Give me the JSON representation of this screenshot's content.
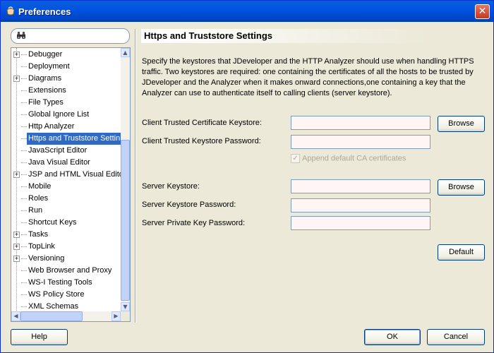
{
  "window": {
    "title": "Preferences"
  },
  "search": {
    "placeholder": ""
  },
  "tree": {
    "items": [
      {
        "label": "Debugger",
        "expandable": true
      },
      {
        "label": "Deployment",
        "expandable": false
      },
      {
        "label": "Diagrams",
        "expandable": true
      },
      {
        "label": "Extensions",
        "expandable": false
      },
      {
        "label": "File Types",
        "expandable": false
      },
      {
        "label": "Global Ignore List",
        "expandable": false
      },
      {
        "label": "Http Analyzer",
        "expandable": false
      },
      {
        "label": "Https and Truststore Settin",
        "expandable": false,
        "selected": true
      },
      {
        "label": "JavaScript Editor",
        "expandable": false
      },
      {
        "label": "Java Visual Editor",
        "expandable": false
      },
      {
        "label": "JSP and HTML Visual Editor",
        "expandable": true
      },
      {
        "label": "Mobile",
        "expandable": false
      },
      {
        "label": "Roles",
        "expandable": false
      },
      {
        "label": "Run",
        "expandable": false
      },
      {
        "label": "Shortcut Keys",
        "expandable": false
      },
      {
        "label": "Tasks",
        "expandable": true
      },
      {
        "label": "TopLink",
        "expandable": true
      },
      {
        "label": "Versioning",
        "expandable": true
      },
      {
        "label": "Web Browser and Proxy",
        "expandable": false
      },
      {
        "label": "WS-I Testing Tools",
        "expandable": false
      },
      {
        "label": "WS Policy Store",
        "expandable": false
      },
      {
        "label": "XML Schemas",
        "expandable": false
      }
    ]
  },
  "settings": {
    "heading": "Https and Truststore Settings",
    "description": "Specify the keystores that JDeveloper and the HTTP Analyzer should use when handling HTTPS traffic. Two keystores are required: one containing the certificates of all the hosts to be trusted by JDeveloper and the Analyzer when it makes onward connections,one containing a key that the Analyzer can use to authenticate itself to calling clients (server keystore).",
    "client_keystore_label": "Client Trusted Certificate Keystore:",
    "client_keystore_value": "",
    "client_password_label": "Client Trusted Keystore Password:",
    "client_password_value": "",
    "append_ca_label": "Append default CA certificates",
    "append_ca_checked": true,
    "server_keystore_label": "Server Keystore:",
    "server_keystore_value": "",
    "server_password_label": "Server Keystore Password:",
    "server_password_value": "",
    "server_private_key_label": "Server Private Key Password:",
    "server_private_key_value": "",
    "browse_label": "Browse",
    "default_label": "Default"
  },
  "footer": {
    "help_label": "Help",
    "ok_label": "OK",
    "cancel_label": "Cancel"
  },
  "colors": {
    "titlebar": "#0054e3",
    "selection": "#316ac5",
    "dialog_bg": "#ece9d8"
  }
}
